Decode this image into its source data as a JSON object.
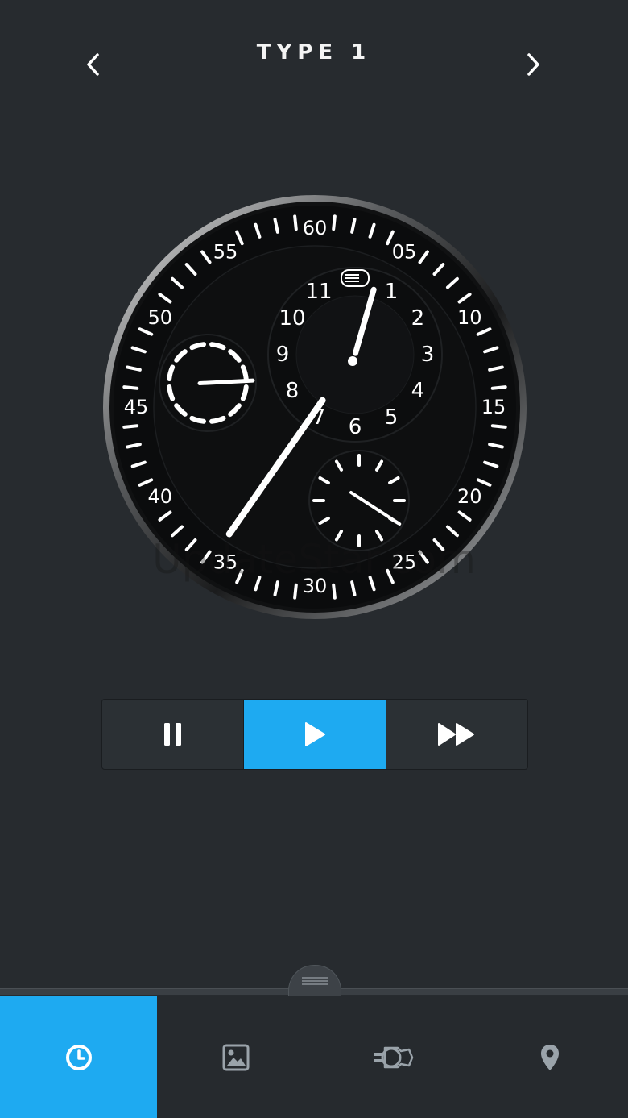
{
  "header": {
    "title": "TYPE 1",
    "prev_icon": "chevron-left-icon",
    "next_icon": "chevron-right-icon"
  },
  "watch": {
    "minute_scale_labels": [
      "60",
      "05",
      "10",
      "15",
      "20",
      "25",
      "30",
      "35",
      "40",
      "45",
      "50",
      "55"
    ],
    "hour_numerals": [
      "1",
      "2",
      "3",
      "4",
      "5",
      "6",
      "7",
      "8",
      "9",
      "10",
      "11"
    ],
    "minute_hand_value": 35,
    "hour_value": 1,
    "seconds_value": 24,
    "day_night_value": 0.3
  },
  "watermark": "UpdateStar.com",
  "controls": {
    "pause_icon": "pause-icon",
    "play_icon": "play-icon",
    "fast_forward_icon": "fast-forward-icon",
    "active": "play"
  },
  "tabs": [
    {
      "icon": "clock-icon",
      "active": true
    },
    {
      "icon": "image-icon",
      "active": false
    },
    {
      "icon": "watch-icon",
      "active": false
    },
    {
      "icon": "location-pin-icon",
      "active": false
    }
  ],
  "colors": {
    "background": "#272b2f",
    "accent": "#1eaaf1",
    "dial": "#0e0f10"
  }
}
